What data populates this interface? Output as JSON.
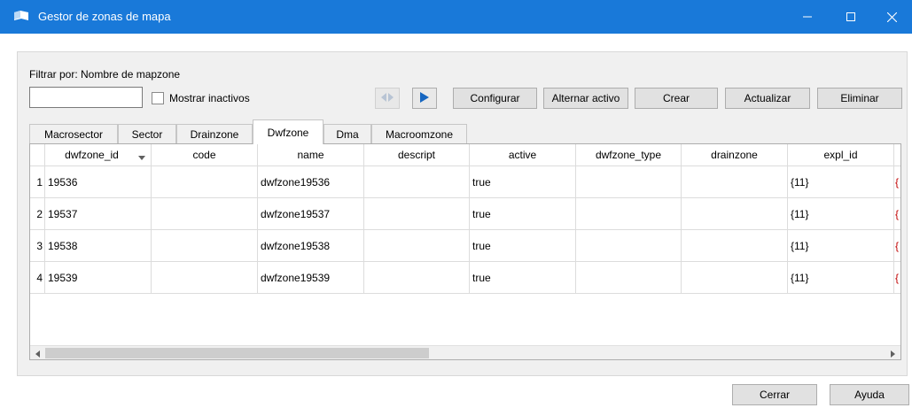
{
  "window": {
    "title": "Gestor de zonas de mapa"
  },
  "filter": {
    "label": "Filtrar por: Nombre de mapzone",
    "value": "",
    "show_inactive_label": "Mostrar inactivos",
    "show_inactive_checked": false
  },
  "toolbar": {
    "configure": "Configurar",
    "toggle_active": "Alternar activo",
    "create": "Crear",
    "refresh": "Actualizar",
    "delete": "Eliminar"
  },
  "tabs": [
    "Macrosector",
    "Sector",
    "Drainzone",
    "Dwfzone",
    "Dma",
    "Macroomzone"
  ],
  "active_tab": "Dwfzone",
  "table": {
    "columns": [
      "dwfzone_id",
      "code",
      "name",
      "descript",
      "active",
      "dwfzone_type",
      "drainzone",
      "expl_id"
    ],
    "rows": [
      {
        "num": "1",
        "cells": [
          "19536",
          "",
          "dwfzone19536",
          "",
          "true",
          "",
          "",
          "{11}"
        ]
      },
      {
        "num": "2",
        "cells": [
          "19537",
          "",
          "dwfzone19537",
          "",
          "true",
          "",
          "",
          "{11}"
        ]
      },
      {
        "num": "3",
        "cells": [
          "19538",
          "",
          "dwfzone19538",
          "",
          "true",
          "",
          "",
          "{11}"
        ]
      },
      {
        "num": "4",
        "cells": [
          "19539",
          "",
          "dwfzone19539",
          "",
          "true",
          "",
          "",
          "{11}"
        ]
      }
    ],
    "overflow_glyph": "{"
  },
  "footer": {
    "close": "Cerrar",
    "help": "Ayuda"
  },
  "colors": {
    "titlebar": "#1979d9",
    "play_icon": "#1565c0"
  },
  "icons": [
    "app-icon",
    "minimize-icon",
    "maximize-icon",
    "close-icon",
    "previous-icon",
    "play-icon",
    "sort-arrow-icon",
    "scroll-left-icon",
    "scroll-right-icon"
  ]
}
